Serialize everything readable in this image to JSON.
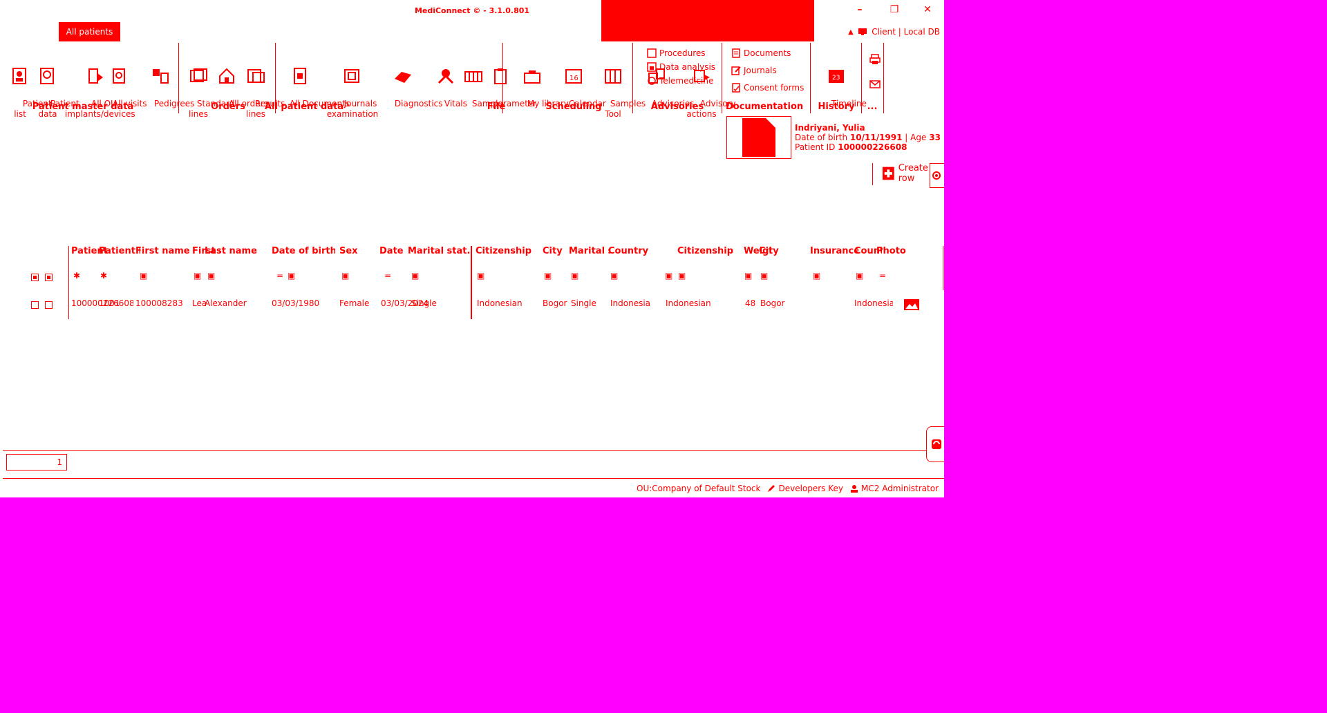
{
  "window": {
    "title": "MediConnect © - 3.1.0.801",
    "minimize": "–",
    "restore": "❐",
    "close": "✕",
    "client_label": "Client | Local DB"
  },
  "pill": {
    "label": "All patients"
  },
  "ribbon": {
    "tools": [
      {
        "label": "Patient\nlist"
      },
      {
        "label": "Patient\ndata"
      },
      {
        "label": "All OU\nimplants/devices"
      },
      {
        "label": "All visits"
      },
      {
        "label": "Pedigrees"
      },
      {
        "label": "Standard\nlines"
      },
      {
        "label": "All orders"
      },
      {
        "label": "Results\nlines"
      },
      {
        "label": "All Documents"
      },
      {
        "label": "Journals\nexamination"
      },
      {
        "label": "Diagnostics"
      },
      {
        "label": "Vitals"
      },
      {
        "label": "Sample"
      },
      {
        "label": "parameter"
      },
      {
        "label": "My library"
      },
      {
        "label": "Calendar"
      },
      {
        "label": "Samples\nTool"
      },
      {
        "label": "Timeline"
      }
    ],
    "groups": {
      "patient_master_data": "Patient master data",
      "orders": "Orders",
      "all_patient_data": "All patient data",
      "file": "File",
      "scheduling": "Scheduling",
      "advisories": "Advisories",
      "documentation": "Documentation",
      "history": "History",
      "more": "..."
    },
    "advisories_items": [
      "Procedures",
      "Data analysis",
      "Telemedicine"
    ],
    "advisory_tool": "Advisory\nactions",
    "advisories_tool": "Advisories",
    "documentation_items": [
      "Documents",
      "Journals",
      "Consent forms"
    ]
  },
  "patient": {
    "name": "Indriyani, Yulia",
    "dob_label": "Date of birth",
    "dob": "10/11/1991",
    "age_label": "Age",
    "age": "33",
    "id_label": "Patient ID",
    "id": "100000226608"
  },
  "create": {
    "label": "Create row"
  },
  "grid": {
    "headers": [
      "Patient",
      "Patient ID",
      "First name",
      "First name",
      "Last name",
      "Date of birth",
      "Sex",
      "Date",
      "Marital stat...",
      "Citizenship",
      "City",
      "Marital status",
      "Country",
      "Citizenship",
      "Weight",
      "City",
      "Insurance",
      "Country",
      "Photo"
    ],
    "row": {
      "patient": "100000226608",
      "patient_id": "1001",
      "first_name": "100008283",
      "first": "Lea",
      "last": "Alexander",
      "dob": "03/03/1980",
      "sex": "Female",
      "date": "03/03/2024",
      "marital": "Single",
      "citizenship": "Indonesian",
      "city": "Bogor",
      "marital2": "Single",
      "country": "Indonesia",
      "citizenship2": "Indonesian",
      "weight": "48",
      "city2": "Bogor",
      "insurance": "",
      "country2": "Indonesia"
    }
  },
  "pager": {
    "page": "1"
  },
  "status": {
    "ou": "OU:Company of Default Stock",
    "key": "Developers Key",
    "user": "MC2 Administrator"
  },
  "colors": {
    "accent": "#ff0000",
    "background": "#ff00ff",
    "panel": "#ffffff"
  }
}
